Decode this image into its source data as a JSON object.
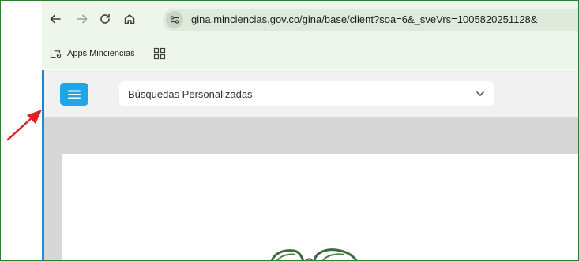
{
  "browser": {
    "url": "gina.minciencias.gov.co/gina/base/client?soa=6&_sveVrs=1005820251128&",
    "nav_icons": [
      "back-arrow-icon",
      "forward-arrow-icon",
      "reload-icon",
      "home-icon",
      "site-info-icon"
    ],
    "bookmarks": [
      {
        "label": "Apps Minciencias",
        "icon": "folder-settings-icon"
      }
    ],
    "apps_icon": "apps-grid-icon"
  },
  "app": {
    "menu_icon": "hamburger-menu-icon",
    "select": {
      "value": "Búsquedas Personalizadas",
      "icon": "chevron-down-icon"
    }
  },
  "colors": {
    "toolbar_bg": "#eef6ec",
    "menu_button": "#1ea7e8",
    "accent_border": "#2a87d0",
    "annotation_arrow": "#e02020",
    "frame_border": "#2e7d32"
  }
}
